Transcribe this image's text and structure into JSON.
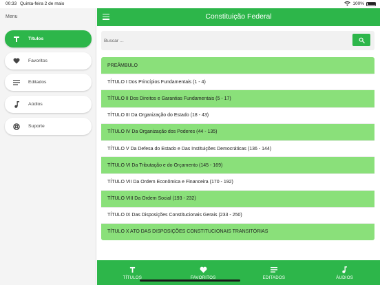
{
  "status": {
    "time": "00:33",
    "date": "Quinta-feira 2 de maio",
    "battery": "100%"
  },
  "sidebar": {
    "title": "Menu",
    "items": [
      {
        "label": "Títulos",
        "icon": "title-T-icon",
        "active": true
      },
      {
        "label": "Favoritos",
        "icon": "heart-icon",
        "active": false
      },
      {
        "label": "Editados",
        "icon": "list-lines-icon",
        "active": false
      },
      {
        "label": "Aúdios",
        "icon": "music-note-icon",
        "active": false
      },
      {
        "label": "Suporte",
        "icon": "lifebuoy-icon",
        "active": false
      }
    ]
  },
  "appbar": {
    "title": "Constituição Federal"
  },
  "search": {
    "placeholder": "Buscar ..."
  },
  "titles": [
    "PREÂMBULO",
    "TÍTULO I Dos Princípios Fundamentais (1 - 4)",
    "TÍTULO II Dos Direitos e Garantias Fundamentais (5 - 17)",
    "TÍTULO III Da Organização do Estado (18 - 43)",
    "TÍTULO IV Da Organização dos Poderes (44 - 135)",
    "TÍTULO V Da Defesa do Estado e Das Instituições Democráticas (136 - 144)",
    "TÍTULO VI Da Tributação e do Orçamento (145 - 169)",
    "TÍTULO VII Da Ordem Econômica e Financeira (170 - 192)",
    "TÍTULO VIII Da Ordem Social (193 - 232)",
    "TÍTULO IX Das Disposições Constitucionais Gerais (233 - 250)",
    "TÍTULO X ATO DAS DISPOSIÇÕES CONSTITUCIONAIS TRANSITÓRIAS"
  ],
  "bottomnav": [
    {
      "label": "TÍTULOS",
      "icon": "title-T-icon"
    },
    {
      "label": "FAVORITOS",
      "icon": "heart-icon"
    },
    {
      "label": "EDITADOS",
      "icon": "list-lines-icon"
    },
    {
      "label": "ÁUDIOS",
      "icon": "music-note-icon"
    }
  ],
  "colors": {
    "primary": "#2db64a",
    "row_highlight": "#8ae07a",
    "sidebar_bg": "#f4f4f4"
  }
}
